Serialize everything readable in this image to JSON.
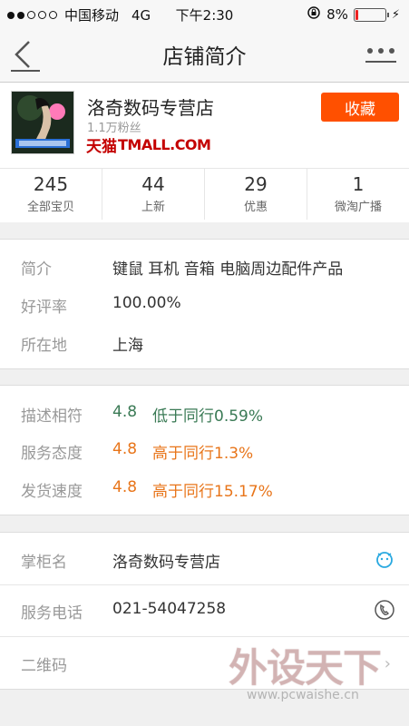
{
  "statusbar": {
    "carrier": "中国移动",
    "network": "4G",
    "time": "下午2:30",
    "battery_percent": "8%",
    "signal_bars": 2,
    "battery_level": 0.08
  },
  "navbar": {
    "title": "店铺简介"
  },
  "store": {
    "name": "洛奇数码专营店",
    "fans": "1.1万粉丝",
    "badge_cn": "天猫",
    "badge_en": "TMALL.COM",
    "favorite_label": "收藏",
    "stats": [
      {
        "value": "245",
        "label": "全部宝贝"
      },
      {
        "value": "44",
        "label": "上新"
      },
      {
        "value": "29",
        "label": "优惠"
      },
      {
        "value": "1",
        "label": "微淘广播"
      }
    ]
  },
  "info": {
    "intro_label": "简介",
    "intro_value": "键鼠 耳机 音箱 电脑周边配件产品",
    "rating_label": "好评率",
    "rating_value": "100.00%",
    "location_label": "所在地",
    "location_value": "上海"
  },
  "scores": [
    {
      "label": "描述相符",
      "score": "4.8",
      "compare": "低于同行0.59%",
      "color": "#3a7a55"
    },
    {
      "label": "服务态度",
      "score": "4.8",
      "compare": "高于同行1.3%",
      "color": "#e8751a"
    },
    {
      "label": "发货速度",
      "score": "4.8",
      "compare": "高于同行15.17%",
      "color": "#e8751a"
    }
  ],
  "contact": {
    "owner_label": "掌柜名",
    "owner_value": "洛奇数码专营店",
    "phone_label": "服务电话",
    "phone_value": "021-54047258",
    "qrcode_label": "二维码"
  },
  "watermark": {
    "title": "外设天下",
    "url": "www.pcwaishe.cn"
  },
  "colors": {
    "accent": "#ff5000",
    "tmall_red": "#c40000",
    "below_green": "#3a7a55",
    "above_orange": "#e8751a"
  }
}
